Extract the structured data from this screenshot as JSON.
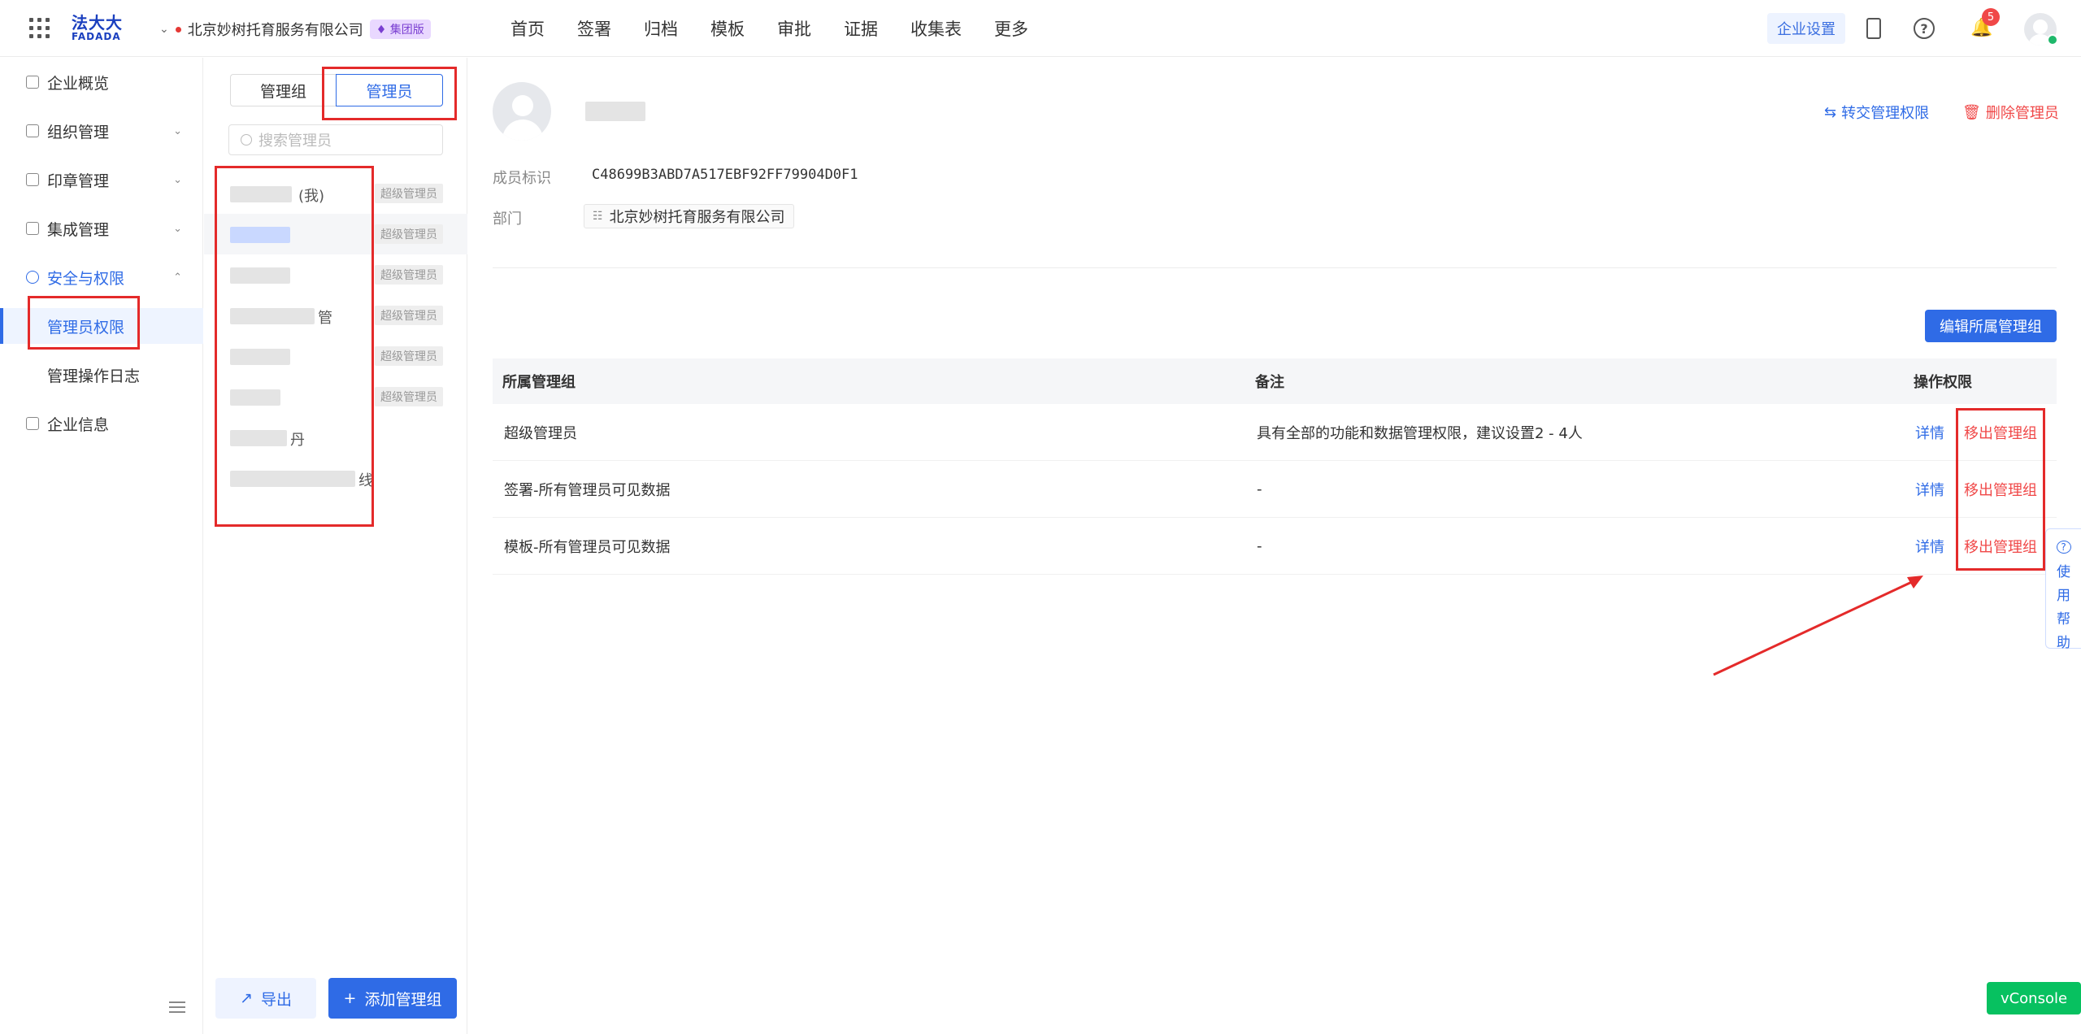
{
  "topbar": {
    "logo_cn": "法大大",
    "logo_en": "FADADA",
    "company": "北京妙树托育服务有限公司",
    "edition_badge": "集团版",
    "nav": [
      "首页",
      "签署",
      "归档",
      "模板",
      "审批",
      "证据",
      "收集表",
      "更多"
    ],
    "settings_label": "企业设置",
    "notification_count": "5"
  },
  "sidebar": {
    "items": [
      {
        "label": "企业概览"
      },
      {
        "label": "组织管理"
      },
      {
        "label": "印章管理"
      },
      {
        "label": "集成管理"
      },
      {
        "label": "安全与权限"
      }
    ],
    "sub_items": [
      {
        "label": "管理员权限"
      },
      {
        "label": "管理操作日志"
      }
    ],
    "last_item": "企业信息"
  },
  "admin_panel": {
    "tab_group": "管理组",
    "tab_admin": "管理员",
    "search_placeholder": "搜索管理员",
    "me_suffix": "(我)",
    "row4_suffix": "管",
    "row7_suffix": "丹",
    "row8_suffix": "线",
    "super_admin_tag": "超级管理员",
    "export_label": "导出",
    "add_label": "添加管理组"
  },
  "detail": {
    "member_id_label": "成员标识",
    "member_id": "C48699B3ABD7A517EBF92FF79904D0F1",
    "dept_label": "部门",
    "dept_value": "北京妙树托育服务有限公司",
    "transfer_label": "转交管理权限",
    "delete_label": "删除管理员",
    "edit_groups_label": "编辑所属管理组"
  },
  "table": {
    "headers": [
      "所属管理组",
      "备注",
      "操作权限"
    ],
    "rows": [
      {
        "group": "超级管理员",
        "note": "具有全部的功能和数据管理权限，建议设置2 - 4人"
      },
      {
        "group": "签署-所有管理员可见数据",
        "note": "-"
      },
      {
        "group": "模板-所有管理员可见数据",
        "note": "-"
      }
    ],
    "action_detail": "详情",
    "action_remove": "移出管理组"
  },
  "help_float": {
    "chars": [
      "使",
      "用",
      "帮",
      "助"
    ]
  },
  "vconsole": "vConsole",
  "colors": {
    "primary": "#2f6be6",
    "danger": "#f04848",
    "annotation": "#e42a2a"
  }
}
